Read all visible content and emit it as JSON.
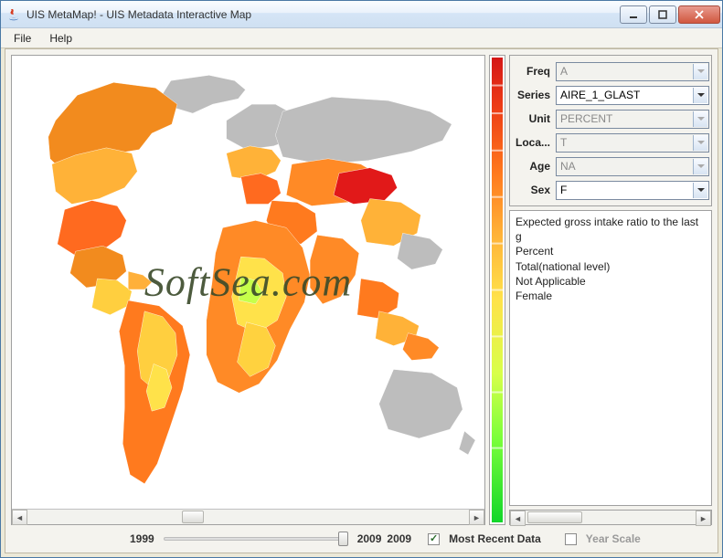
{
  "window": {
    "title": "UIS MetaMap! - UIS Metadata Interactive Map"
  },
  "menu": {
    "file": "File",
    "help": "Help"
  },
  "filters": {
    "freq": {
      "label": "Freq",
      "value": "A",
      "enabled": false
    },
    "series": {
      "label": "Series",
      "value": "AIRE_1_GLAST",
      "enabled": true
    },
    "unit": {
      "label": "Unit",
      "value": "PERCENT",
      "enabled": false
    },
    "loca": {
      "label": "Loca...",
      "value": "T",
      "enabled": false
    },
    "age": {
      "label": "Age",
      "value": "NA",
      "enabled": false
    },
    "sex": {
      "label": "Sex",
      "value": "F",
      "enabled": true
    }
  },
  "description": {
    "line1": "Expected gross intake ratio to the last g",
    "line2": "Percent",
    "line3": "Total(national level)",
    "line4": "Not Applicable",
    "line5": "Female"
  },
  "timeline": {
    "start": "1999",
    "end": "2009",
    "current": "2009",
    "most_recent_label": "Most Recent Data",
    "most_recent_checked": true,
    "year_scale_label": "Year Scale",
    "year_scale_checked": false
  },
  "watermark": "SoftSea.com"
}
